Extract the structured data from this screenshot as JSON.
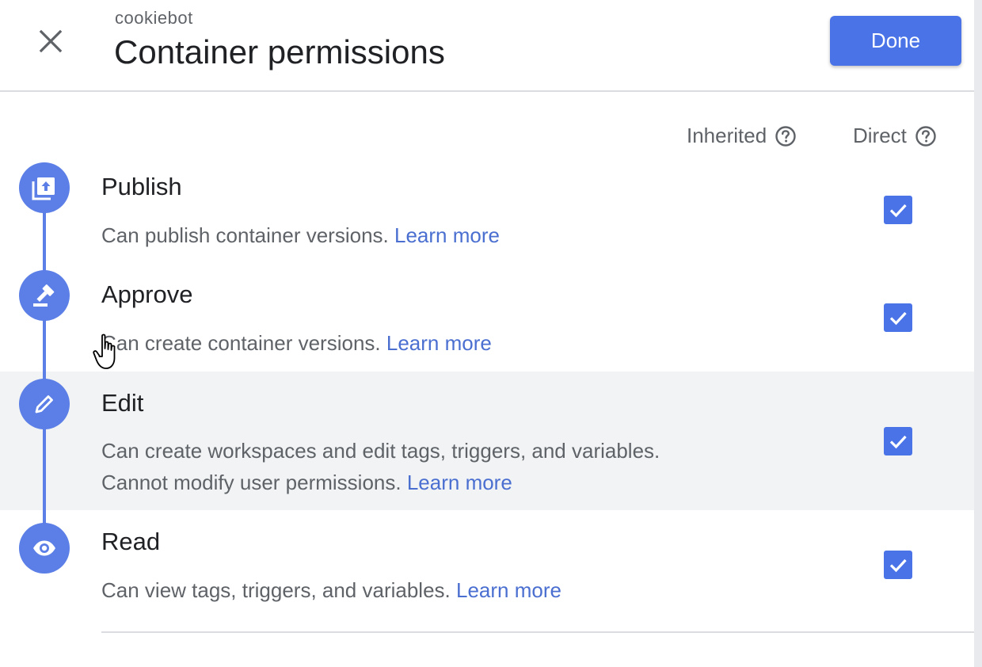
{
  "header": {
    "subtitle": "cookiebot",
    "title": "Container permissions",
    "done_label": "Done",
    "close_icon": "close-icon"
  },
  "columns": {
    "inherited": "Inherited",
    "direct": "Direct"
  },
  "permissions": [
    {
      "title": "Publish",
      "desc": "Can publish container versions.",
      "link": "Learn more",
      "icon": "publish-icon",
      "direct_checked": true
    },
    {
      "title": "Approve",
      "desc": "Can create container versions.",
      "link": "Learn more",
      "icon": "gavel-icon",
      "direct_checked": true
    },
    {
      "title": "Edit",
      "desc": "Can create workspaces and edit tags, triggers, and variables. Cannot modify user permissions.",
      "link": "Learn more",
      "icon": "pencil-icon",
      "direct_checked": true
    },
    {
      "title": "Read",
      "desc": "Can view tags, triggers, and variables.",
      "link": "Learn more",
      "icon": "eye-icon",
      "direct_checked": true
    }
  ],
  "colors": {
    "accent": "#4a73e8",
    "timeline": "#5b7fe6",
    "link": "#4a6fd0",
    "highlight_row": "#f1f3f4"
  }
}
